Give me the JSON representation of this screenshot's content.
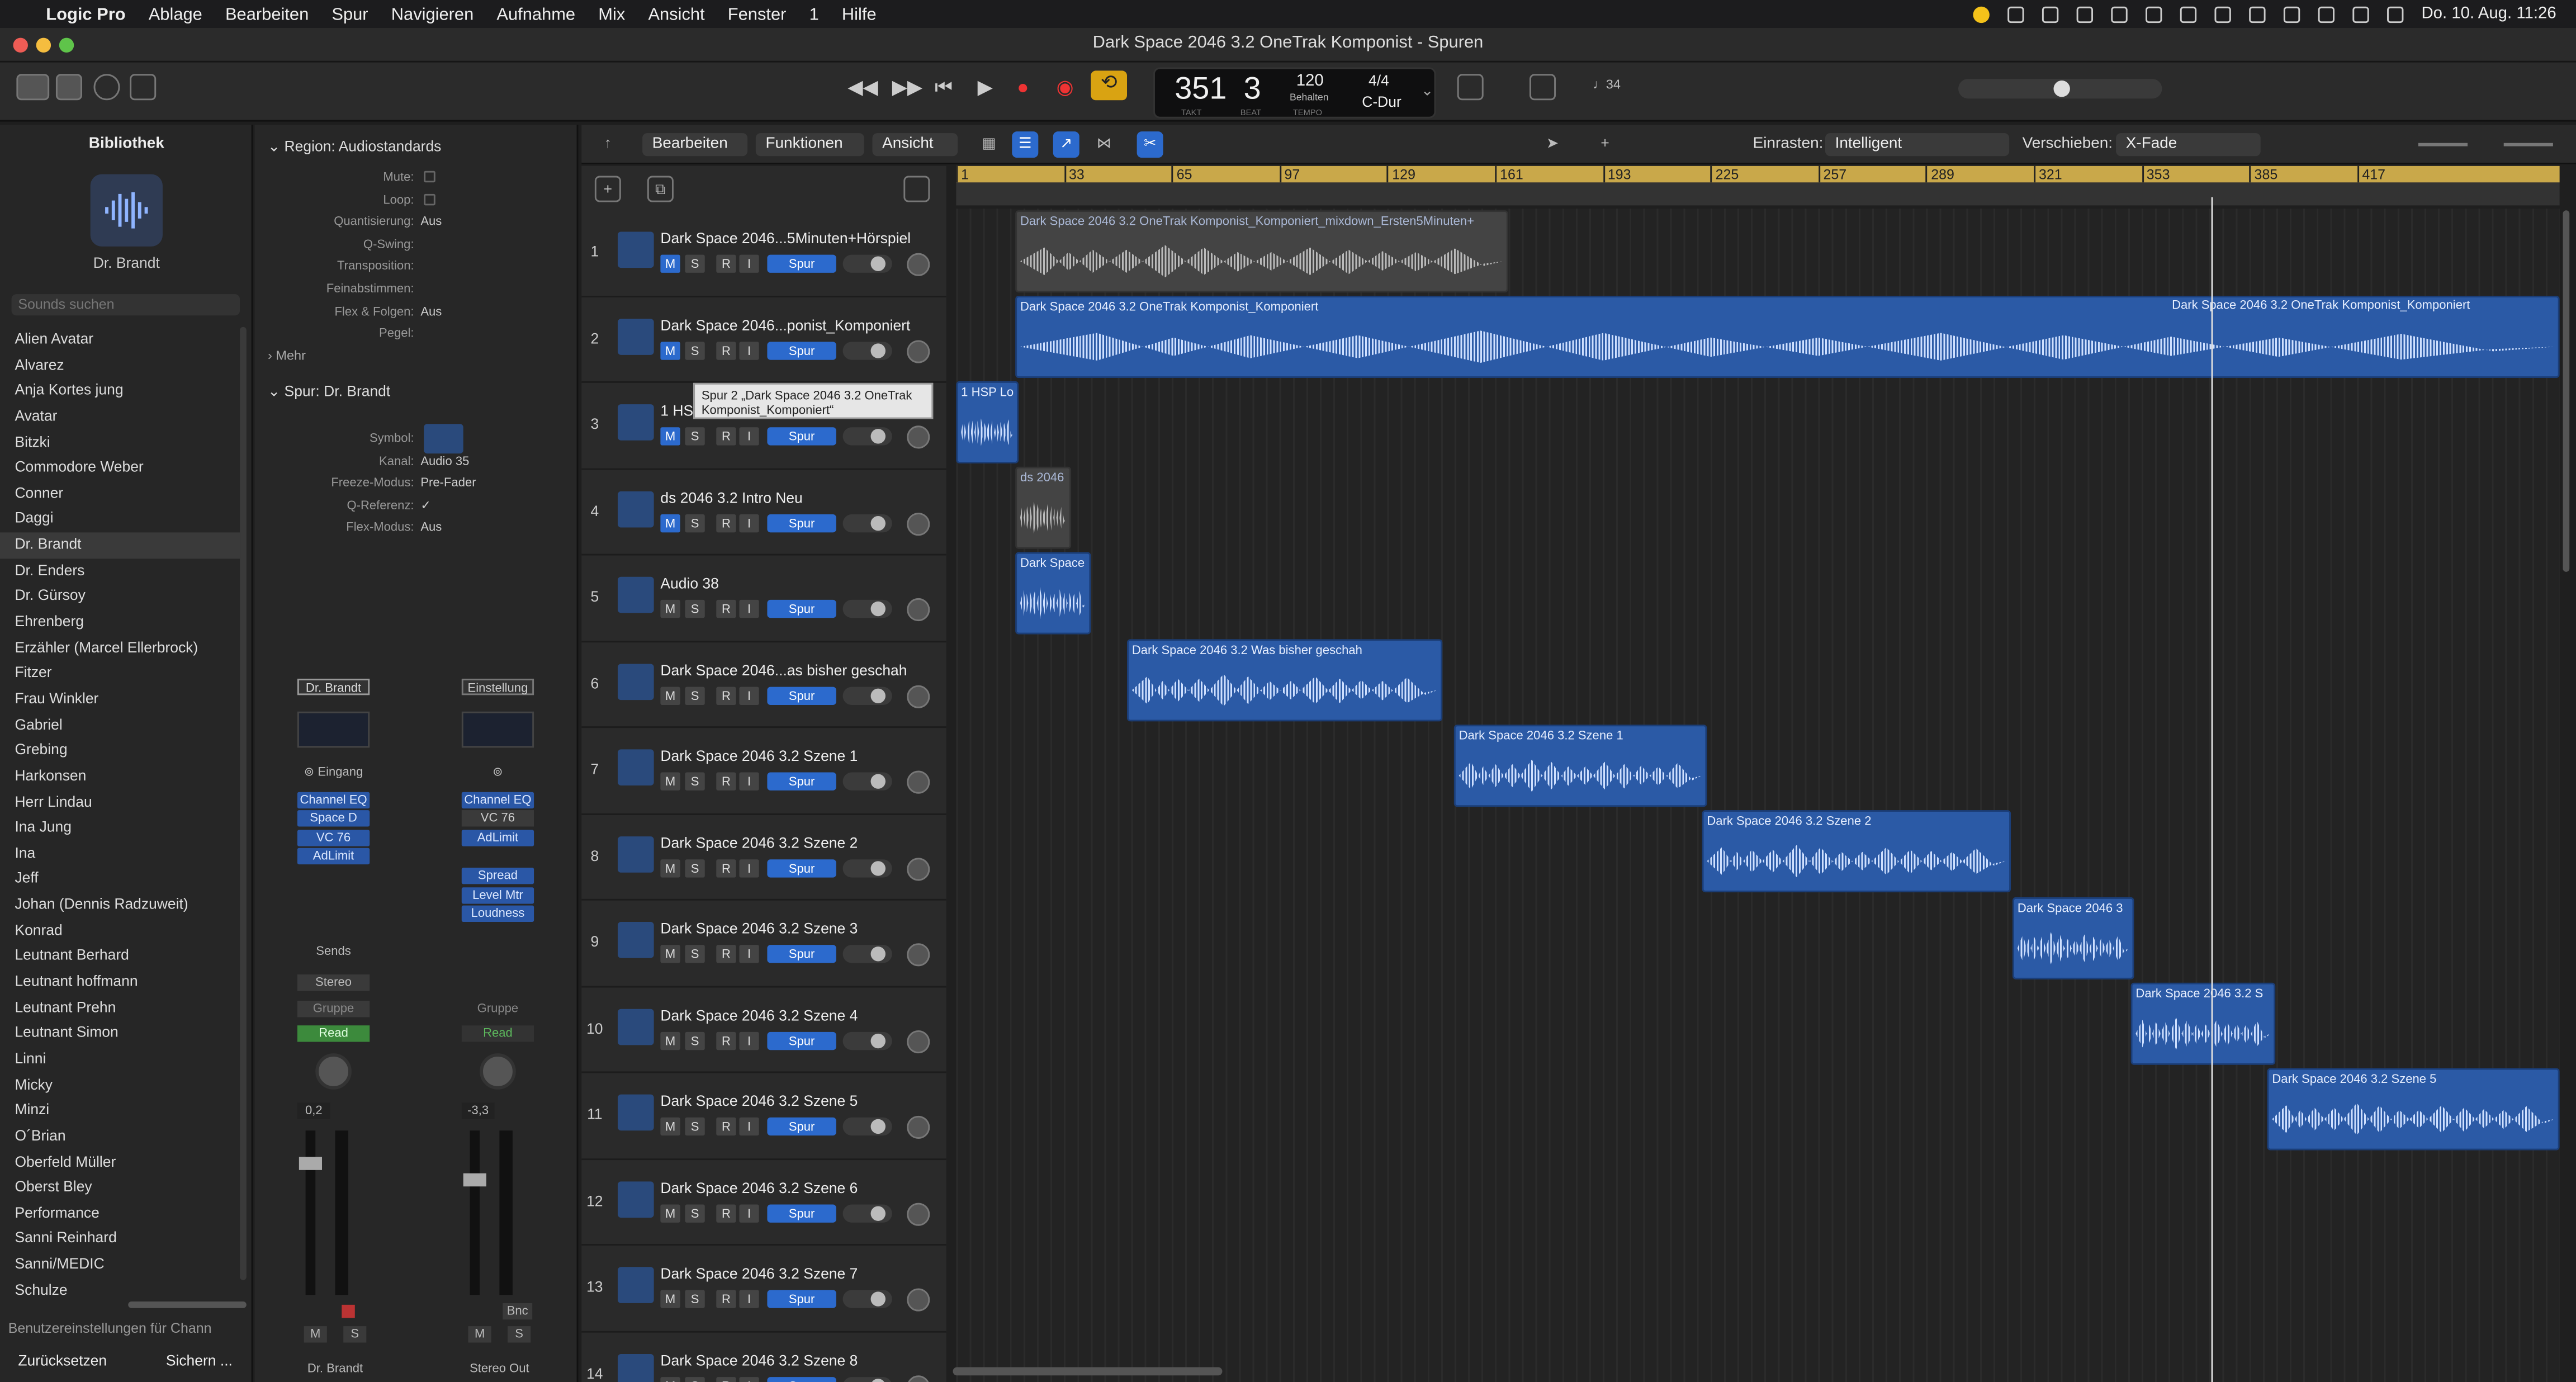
{
  "menubar": {
    "app": "Logic Pro",
    "items": [
      "Ablage",
      "Bearbeiten",
      "Spur",
      "Navigieren",
      "Aufnahme",
      "Mix",
      "Ansicht",
      "Fenster",
      "1",
      "Hilfe"
    ],
    "datetime": "Do. 10. Aug.  11:26"
  },
  "window": {
    "title": "Dark Space 2046 3.2 OneTrak Komponist - Spuren"
  },
  "lcd": {
    "bar": "351",
    "beat": "3",
    "bar_label": "TAKT",
    "beat_label": "BEAT",
    "tempo": "120",
    "tempo_mode": "Behalten",
    "tempo_label": "TEMPO",
    "signature": "4/4",
    "key": "C-Dur"
  },
  "toolbar": {
    "count_in": "♩34"
  },
  "library": {
    "title": "Bibliothek",
    "patch_name": "Dr. Brandt",
    "search_placeholder": "Sounds suchen",
    "items": [
      "Alien Avatar",
      "Alvarez",
      "Anja Kortes jung",
      "Avatar",
      "Bitzki",
      "Commodore Weber",
      "Conner",
      "Daggi",
      "Dr. Brandt",
      "Dr. Enders",
      "Dr. Gürsoy",
      "Ehrenberg",
      "Erzähler (Marcel Ellerbrock)",
      "Fitzer",
      "Frau Winkler",
      "Gabriel",
      "Grebing",
      "Harkonsen",
      "Herr Lindau",
      "Ina Jung",
      "Ina",
      "Jeff",
      "Johan (Dennis Radzuweit)",
      "Konrad",
      "Leutnant Berhard",
      "Leutnant hoffmann",
      "Leutnant Prehn",
      "Leutnant Simon",
      "Linni",
      "Micky",
      "Minzi",
      "O´Brian",
      "Oberfeld Müller",
      "Oberst Bley",
      "Performance",
      "Sanni Reinhard",
      "Sanni/MEDIC",
      "Schulze"
    ],
    "selected": "Dr. Brandt",
    "footer": "Benutzereinstellungen für Chann",
    "reset": "Zurücksetzen",
    "save": "Sichern ..."
  },
  "inspector": {
    "region_header": "Region: Audiostandards",
    "region_rows": [
      {
        "k": "Mute:",
        "v": ""
      },
      {
        "k": "Loop:",
        "v": ""
      },
      {
        "k": "Quantisierung:",
        "v": "Aus"
      },
      {
        "k": "Q-Swing:",
        "v": ""
      },
      {
        "k": "Transposition:",
        "v": ""
      },
      {
        "k": "Feinabstimmen:",
        "v": ""
      },
      {
        "k": "Flex & Folgen:",
        "v": "Aus"
      },
      {
        "k": "Pegel:",
        "v": ""
      }
    ],
    "more": "Mehr",
    "track_header": "Spur:",
    "track_name": "Dr. Brandt",
    "track_rows": [
      {
        "k": "Symbol:",
        "v": ""
      },
      {
        "k": "Kanal:",
        "v": "Audio 35"
      },
      {
        "k": "Freeze-Modus:",
        "v": "Pre-Fader"
      },
      {
        "k": "Q-Referenz:",
        "v": "✓"
      },
      {
        "k": "Flex-Modus:",
        "v": "Aus"
      }
    ]
  },
  "strip1": {
    "setting": "Dr. Brandt",
    "input": "Eingang",
    "plugins": [
      "Channel EQ",
      "Space D",
      "VC 76",
      "AdLimit"
    ],
    "sends": "Sends",
    "output": "Stereo",
    "group": "Gruppe",
    "automation": "Read",
    "volume": "0,2",
    "mute": "M",
    "solo": "S",
    "name": "Dr. Brandt"
  },
  "strip2": {
    "setting": "Einstellung",
    "plugins": [
      "Channel EQ",
      "VC 76",
      "AdLimit"
    ],
    "plugins2": [
      "Spread",
      "Level Mtr",
      "Loudness"
    ],
    "group": "Gruppe",
    "automation": "Read",
    "volume": "-3,3",
    "mute": "M",
    "solo": "S",
    "bnc": "Bnc",
    "name": "Stereo Out"
  },
  "localbar": {
    "edit": "Bearbeiten",
    "functions": "Funktionen",
    "view": "Ansicht",
    "snap_label": "Einrasten:",
    "snap_value": "Intelligent",
    "drag_label": "Verschieben:",
    "drag_value": "X-Fade"
  },
  "ruler": [
    "1",
    "33",
    "65",
    "97",
    "129",
    "161",
    "193",
    "225",
    "257",
    "289",
    "321",
    "353",
    "385",
    "417"
  ],
  "tracks": [
    {
      "n": "1",
      "name": "Dark Space 2046...5Minuten+Hörspiel",
      "mute": true
    },
    {
      "n": "2",
      "name": "Dark Space 2046...ponist_Komponiert",
      "mute": true
    },
    {
      "n": "3",
      "name": "1 HSP",
      "mute": true
    },
    {
      "n": "4",
      "name": "ds 2046 3.2 Intro Neu",
      "mute": true
    },
    {
      "n": "5",
      "name": "Audio 38",
      "mute": false
    },
    {
      "n": "6",
      "name": "Dark Space 2046...as bisher geschah",
      "mute": false
    },
    {
      "n": "7",
      "name": "Dark Space 2046 3.2 Szene 1",
      "mute": false
    },
    {
      "n": "8",
      "name": "Dark Space 2046 3.2 Szene 2",
      "mute": false
    },
    {
      "n": "9",
      "name": "Dark Space 2046 3.2 Szene 3",
      "mute": false
    },
    {
      "n": "10",
      "name": "Dark Space 2046 3.2 Szene 4",
      "mute": false
    },
    {
      "n": "11",
      "name": "Dark Space 2046 3.2 Szene 5",
      "mute": false
    },
    {
      "n": "12",
      "name": "Dark Space 2046 3.2 Szene 6",
      "mute": false
    },
    {
      "n": "13",
      "name": "Dark Space 2046 3.2 Szene 7",
      "mute": false
    },
    {
      "n": "14",
      "name": "Dark Space 2046 3.2 Szene 8",
      "mute": false
    }
  ],
  "track_buttons": {
    "m": "M",
    "s": "S",
    "r": "R",
    "i": "I",
    "spur": "Spur"
  },
  "regions": [
    "Dark Space 2046 3.2 OneTrak Komponist_Komponiert_mixdown_Ersten5Minuten+",
    "Dark Space 2046 3.2 OneTrak Komponist_Komponiert",
    "Dark Space 2046 3.2 OneTrak Komponist_Komponiert",
    "1 HSP Lo",
    "ds 2046",
    "Dark Space",
    "Dark Space 2046 3.2 Was bisher geschah",
    "Dark Space 2046 3.2 Szene 1",
    "Dark Space 2046 3.2 Szene 2",
    "Dark Space 2046 3",
    "Dark Space 2046 3.2 S",
    "Dark Space 2046 3.2 Szene 5"
  ],
  "tooltip": "Spur 2 „Dark Space 2046 3.2 OneTrak Komponist_Komponiert“"
}
